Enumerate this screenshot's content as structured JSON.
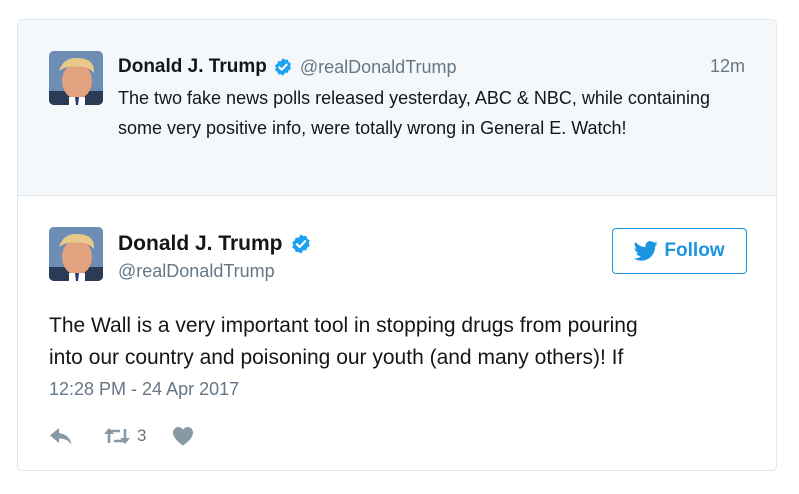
{
  "parent_tweet": {
    "name": "Donald J. Trump",
    "handle": "@realDonaldTrump",
    "time": "12m",
    "text": "The two fake news polls released yesterday, ABC & NBC, while containing some very positive info, were totally wrong in General E. Watch!"
  },
  "tweet": {
    "name": "Donald J. Trump",
    "handle": "@realDonaldTrump",
    "follow_label": "Follow",
    "text_line1": "The Wall is a very important tool in stopping drugs from pouring",
    "text_line2": "into our country and poisoning our youth (and many others)! If",
    "date": "12:28 PM - 24 Apr 2017",
    "retweet_count": "3"
  },
  "icons": {
    "verified": "verified-badge-icon",
    "follow": "twitter-bird-icon",
    "reply": "reply-icon",
    "retweet": "retweet-icon",
    "like": "heart-icon"
  },
  "colors": {
    "accent": "#1b95e0",
    "verified": "#1da1f2",
    "muted": "#657786",
    "action": "#8899a6",
    "parent_bg": "#f5f8fa"
  }
}
